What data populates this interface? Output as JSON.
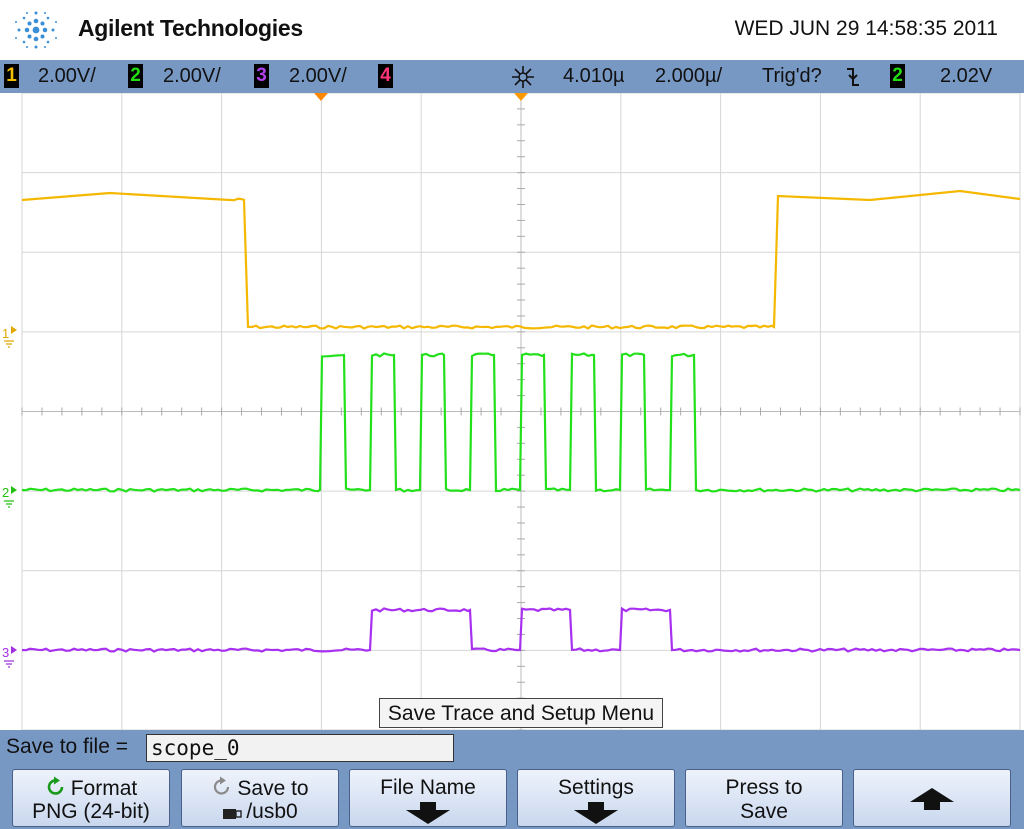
{
  "header": {
    "brand": "Agilent Technologies",
    "datetime": "WED JUN 29 14:58:35 2011"
  },
  "status": {
    "ch1": {
      "num": "1",
      "scale": "2.00V/",
      "color": "#f2c000"
    },
    "ch2": {
      "num": "2",
      "scale": "2.00V/",
      "color": "#22dd11"
    },
    "ch3": {
      "num": "3",
      "scale": "2.00V/",
      "color": "#b040f0"
    },
    "ch4": {
      "num": "4",
      "color": "#ff3377"
    },
    "delay": "4.010µ",
    "timebase": "2.000µ/",
    "trigger_state": "Trig'd?",
    "trigger_source": "2",
    "trigger_level": "2.02V"
  },
  "waveform": {
    "ch1_marker": "1",
    "ch2_marker": "2",
    "ch3_marker": "3"
  },
  "menu": {
    "title": "Save Trace and Setup Menu",
    "save_to_file_label": "Save to file =",
    "filename": "scope_0"
  },
  "softkeys": {
    "format_line1": "Format",
    "format_line2": "PNG (24-bit)",
    "saveto_line1": "Save to",
    "saveto_line2": "/usb0",
    "filename_line1": "File Name",
    "settings_line1": "Settings",
    "press_line1": "Press to",
    "press_line2": "Save"
  }
}
